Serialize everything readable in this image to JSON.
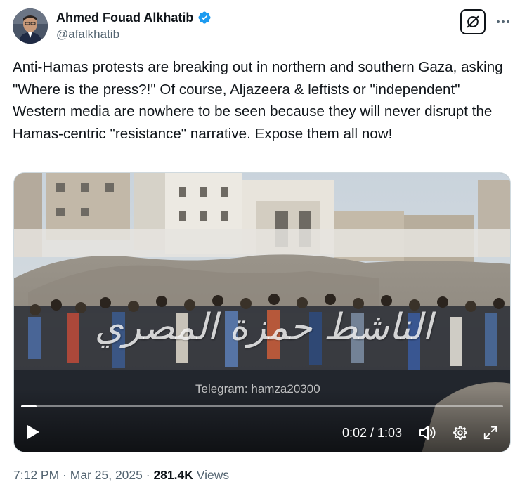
{
  "author": {
    "name": "Ahmed Fouad Alkhatib",
    "handle": "@afalkhatib",
    "verified": true
  },
  "tweet": {
    "text": "Anti-Hamas protests are breaking out in northern and southern Gaza, asking \"Where is the press?!\" Of course, Aljazeera & leftists or \"independent\" Western media are nowhere to be seen because they will never disrupt the Hamas-centric \"resistance\" narrative. Expose them all now!"
  },
  "video": {
    "watermark": "الناشط حمزة المصري",
    "telegram": "Telegram: hamza20300",
    "time_display": "0:02 / 1:03",
    "progress_fraction": 0.032
  },
  "meta": {
    "time": "7:12 PM",
    "separator1": " · ",
    "date": "Mar 25, 2025",
    "separator2": " · ",
    "views_count": "281.4K",
    "views_label": " Views"
  },
  "icons": {
    "verified": "verified-badge-icon",
    "grok": "grok-icon",
    "more": "more-dots-icon",
    "play": "play-icon",
    "volume": "volume-icon",
    "settings": "settings-gear-icon",
    "expand": "fullscreen-icon"
  },
  "colors": {
    "verified_blue": "#1d9bf0",
    "text_primary": "#0f1419",
    "text_secondary": "#536471",
    "border": "#cfd9de"
  }
}
